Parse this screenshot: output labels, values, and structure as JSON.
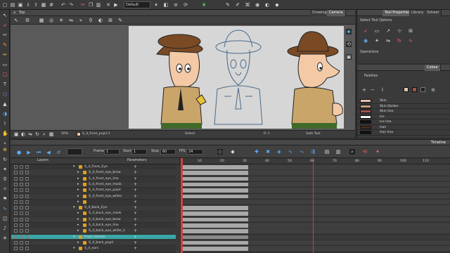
{
  "topbar": {
    "workspace": "Default"
  },
  "viewer": {
    "tab_label": "Top",
    "tabs": [
      "Drawing",
      "Camera"
    ],
    "zoom": "50%",
    "drawing_name": "S_4_front_pupil-1",
    "tool": "Select",
    "frame": "Fr 1",
    "mode": "Safe Tool"
  },
  "tool_properties": {
    "tabs": [
      "Tool Properties",
      "Library",
      "Xsheet"
    ],
    "title": "Select Tool Options",
    "operations_label": "Operations"
  },
  "colour": {
    "tab": "Colour",
    "palettes_label": "Palettes",
    "swatches": [
      {
        "name": "Skin",
        "color": "#e6c2ae"
      },
      {
        "name": "Skin Darker",
        "color": "#c79c86"
      },
      {
        "name": "Skin line",
        "color": "#a0554a"
      },
      {
        "name": "Ice",
        "color": "#f4f4f4"
      },
      {
        "name": "Ice line",
        "color": "#111111"
      },
      {
        "name": "Hair",
        "color": "#4a2a1a"
      },
      {
        "name": "Hair line",
        "color": "#111111"
      }
    ]
  },
  "timeline": {
    "title": "Timeline",
    "frame_label": "Frame",
    "frame": "1",
    "start_label": "Start",
    "start": "1",
    "stop_label": "Stop",
    "stop": "60",
    "fps_label": "FPS",
    "fps": "24",
    "layers_label": "Layers",
    "params_label": "Parameters",
    "ruler": [
      "10",
      "20",
      "30",
      "40",
      "50",
      "60",
      "70",
      "80",
      "90",
      "100",
      "110"
    ],
    "rows": [
      {
        "name": "S_4_Front_Eye",
        "indent": 0,
        "sel": false
      },
      {
        "name": "S_4_front_eye_brow",
        "indent": 1,
        "sel": false
      },
      {
        "name": "S_4_front_eye_line",
        "indent": 1,
        "sel": false
      },
      {
        "name": "S_4_front_eye_mask",
        "indent": 1,
        "sel": false
      },
      {
        "name": "S_4_front_eye_pupil",
        "indent": 1,
        "sel": false
      },
      {
        "name": "S_4_front_eye_white",
        "indent": 1,
        "sel": false
      },
      {
        "name": "",
        "indent": 1,
        "sel": false
      },
      {
        "name": "S_4_Back_Eye",
        "indent": 0,
        "sel": false
      },
      {
        "name": "S_4_back_eye_mask",
        "indent": 1,
        "sel": false
      },
      {
        "name": "S_4_back_eye_brow",
        "indent": 1,
        "sel": false
      },
      {
        "name": "S_4_back_eye_line",
        "indent": 1,
        "sel": false
      },
      {
        "name": "S_4_back_eye_white_1",
        "indent": 1,
        "sel": false
      },
      {
        "name": "Pupil_Handle",
        "indent": 0,
        "sel": true
      },
      {
        "name": "S_4_back_pupil",
        "indent": 1,
        "sel": false
      },
      {
        "name": "S_4_ears",
        "indent": 0,
        "sel": false
      }
    ]
  }
}
